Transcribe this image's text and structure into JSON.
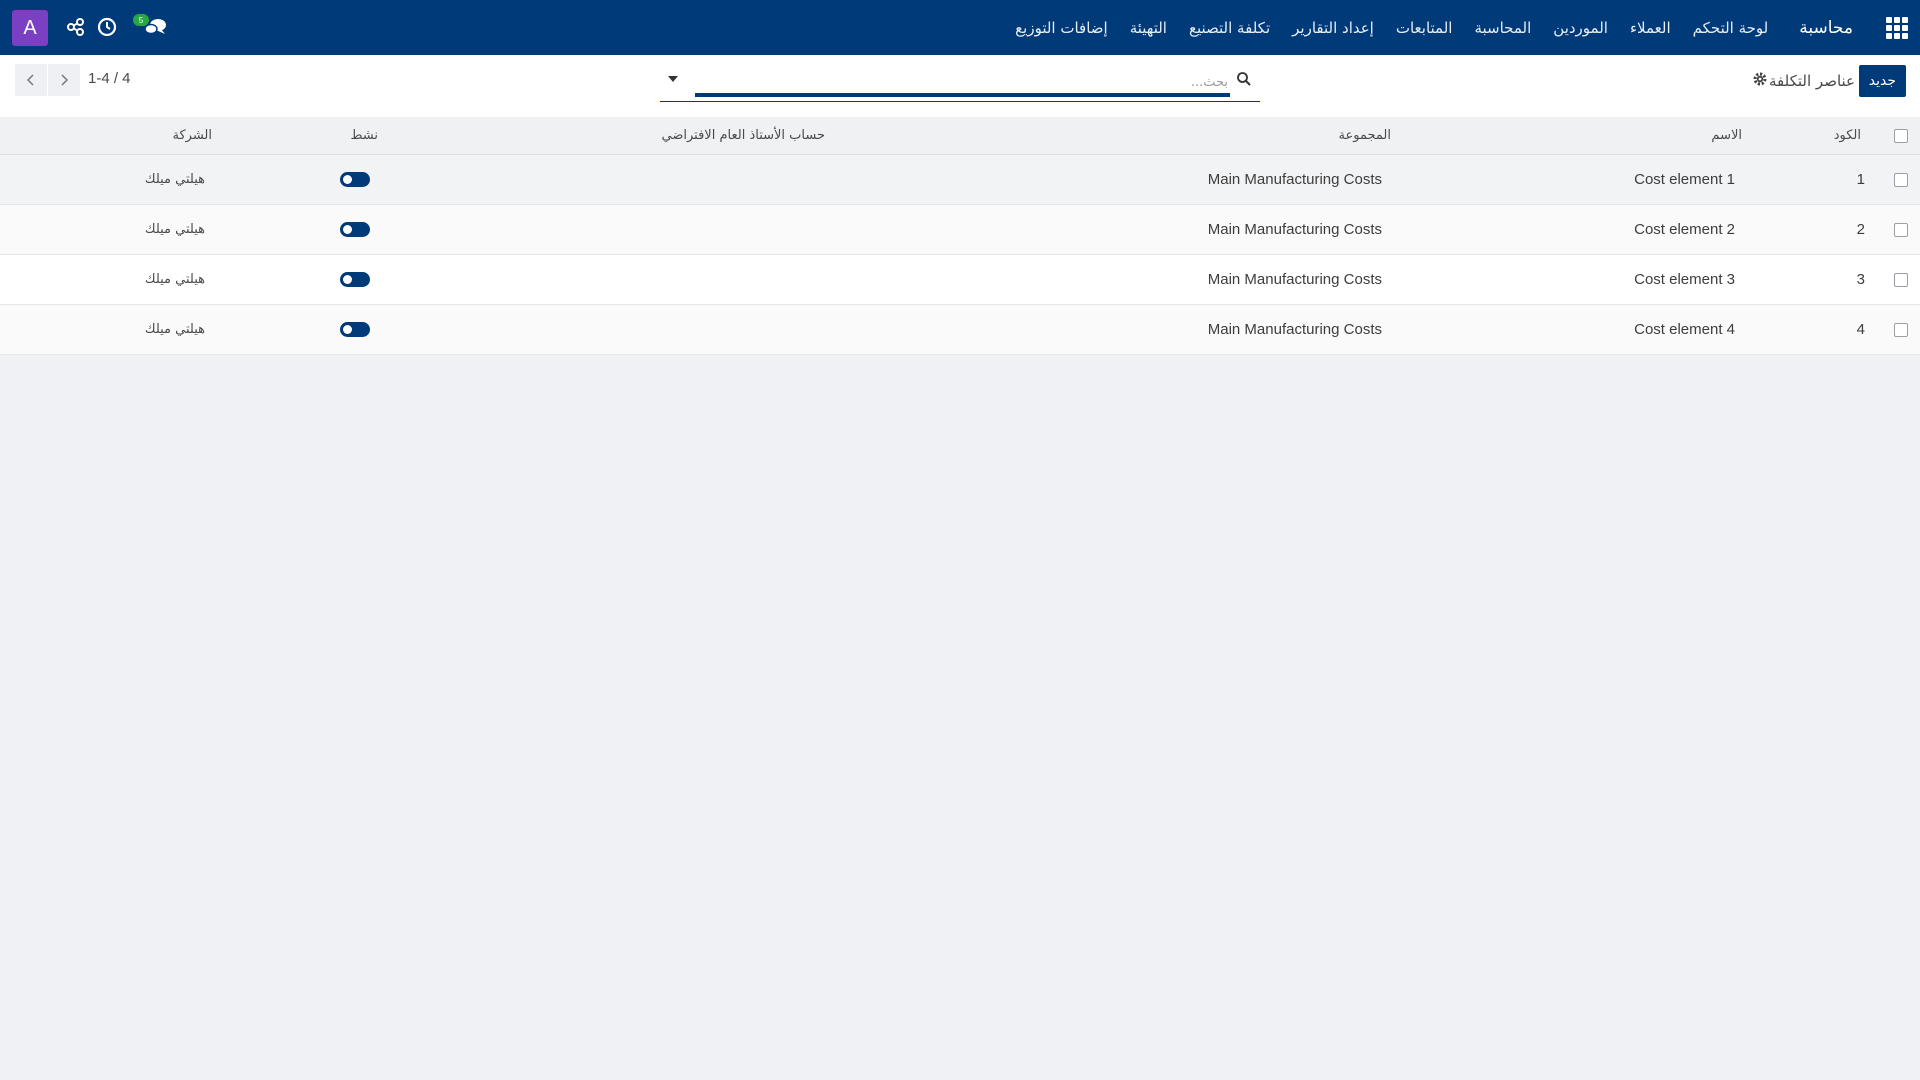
{
  "navbar": {
    "brand": "محاسبة",
    "menu": [
      "لوحة التحكم",
      "العملاء",
      "الموردين",
      "المحاسبة",
      "المتابعات",
      "إعداد التقارير",
      "تكلفة التصنيع",
      "التهيئة",
      "إضافات التوزيع"
    ],
    "avatar_letter": "A",
    "chat_badge": "5",
    "icons": [
      "apps-icon",
      "chat-icon",
      "clock-icon",
      "share-icon"
    ],
    "background": "#013a79"
  },
  "control": {
    "new_button": "جديد",
    "title": "عناصر التكلفة",
    "search_placeholder": "بحث...",
    "pager": "1-4 / 4"
  },
  "table": {
    "columns": [
      "الكود",
      "الاسم",
      "المجموعة",
      "حساب الأستاذ العام الافتراضي",
      "نشط",
      "الشركة"
    ],
    "rows": [
      {
        "code": "1",
        "name": "Cost element 1",
        "group": "Main Manufacturing Costs",
        "account": "",
        "active": true,
        "company": "هيلتي ميلك"
      },
      {
        "code": "2",
        "name": "Cost element 2",
        "group": "Main Manufacturing Costs",
        "account": "",
        "active": true,
        "company": "هيلتي ميلك"
      },
      {
        "code": "3",
        "name": "Cost element 3",
        "group": "Main Manufacturing Costs",
        "account": "",
        "active": true,
        "company": "هيلتي ميلك"
      },
      {
        "code": "4",
        "name": "Cost element 4",
        "group": "Main Manufacturing Costs",
        "account": "",
        "active": true,
        "company": "هيلتي ميلك"
      }
    ]
  }
}
